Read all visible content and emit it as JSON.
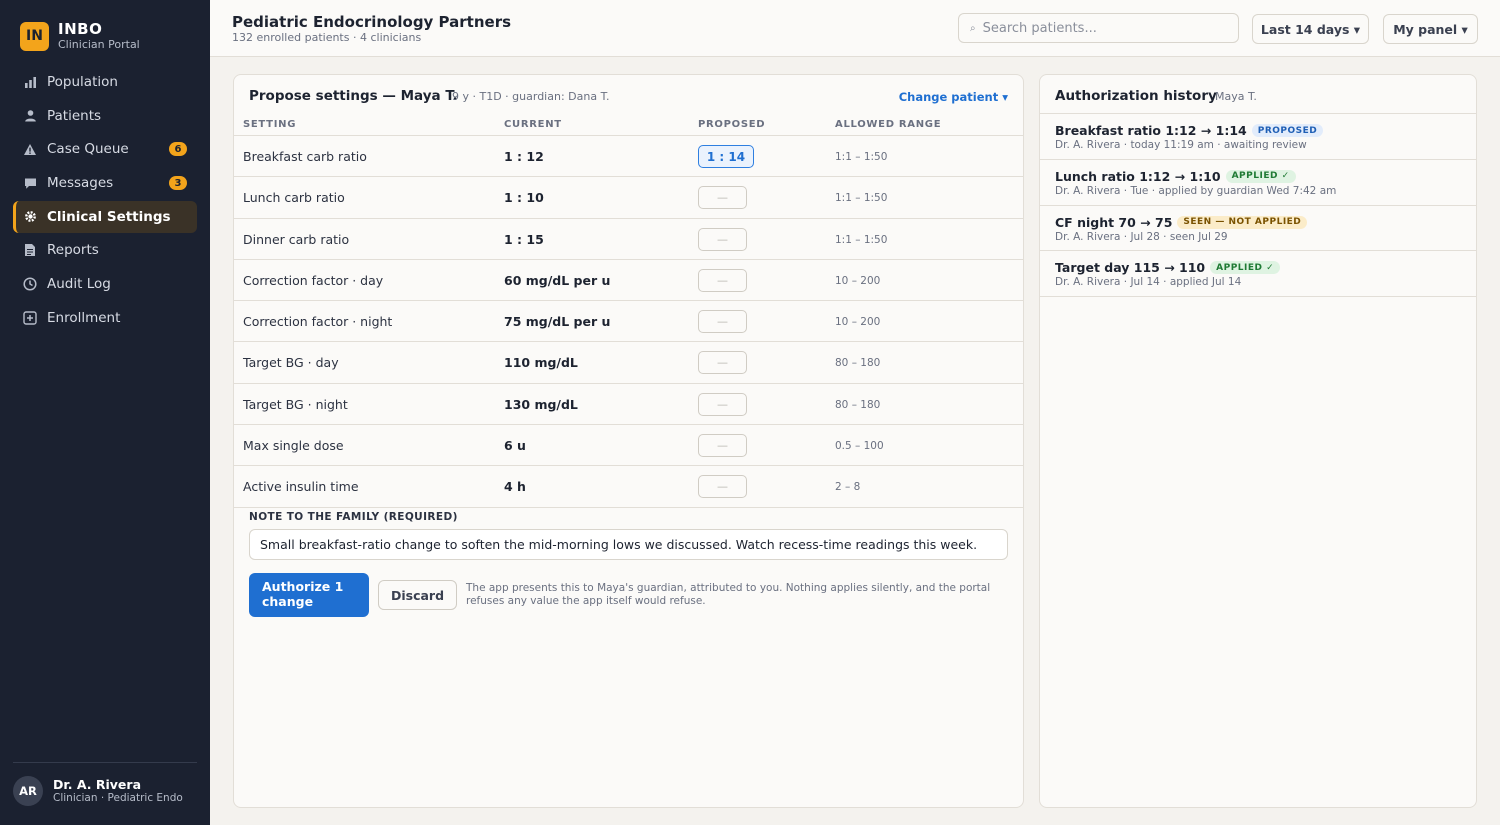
{
  "brand": {
    "logo": "IN",
    "name": "INBO",
    "subtitle": "Clinician Portal"
  },
  "nav": [
    {
      "label": "Population",
      "icon": "bar-chart-icon",
      "badge": ""
    },
    {
      "label": "Patients",
      "icon": "person-icon",
      "badge": ""
    },
    {
      "label": "Case Queue",
      "icon": "warning-icon",
      "badge": "6"
    },
    {
      "label": "Messages",
      "icon": "chat-icon",
      "badge": "3"
    },
    {
      "label": "Clinical Settings",
      "icon": "gear-icon",
      "badge": "",
      "active": true
    },
    {
      "label": "Reports",
      "icon": "document-icon",
      "badge": ""
    },
    {
      "label": "Audit Log",
      "icon": "clock-icon",
      "badge": ""
    },
    {
      "label": "Enrollment",
      "icon": "plus-box-icon",
      "badge": ""
    }
  ],
  "user": {
    "initials": "AR",
    "name": "Dr. A. Rivera",
    "role": "Clinician · Pediatric Endo"
  },
  "header": {
    "title": "Pediatric Endocrinology Partners",
    "subtitle": "132 enrolled patients · 4 clinicians",
    "search_placeholder": "Search patients...",
    "search_icon_glyph": "⌕",
    "range_label": "Last 14 days ▾",
    "panel_label": "My panel ▾"
  },
  "settings_panel": {
    "title": "Propose settings — Maya T.",
    "meta": "9 y · T1D · guardian: Dana T.",
    "change_patient": "Change patient ▾",
    "columns": {
      "setting": "SETTING",
      "current": "CURRENT",
      "proposed": "PROPOSED",
      "range": "ALLOWED RANGE"
    },
    "rows": [
      {
        "setting": "Breakfast carb ratio",
        "current": "1 : 12",
        "proposed": "1 : 14",
        "range": "1:1 – 1:50"
      },
      {
        "setting": "Lunch carb ratio",
        "current": "1 : 10",
        "proposed": "—",
        "range": "1:1 – 1:50"
      },
      {
        "setting": "Dinner carb ratio",
        "current": "1 : 15",
        "proposed": "—",
        "range": "1:1 – 1:50"
      },
      {
        "setting": "Correction factor · day",
        "current": "60 mg/dL per u",
        "proposed": "—",
        "range": "10 – 200"
      },
      {
        "setting": "Correction factor · night",
        "current": "75 mg/dL per u",
        "proposed": "—",
        "range": "10 – 200"
      },
      {
        "setting": "Target BG · day",
        "current": "110 mg/dL",
        "proposed": "—",
        "range": "80 – 180"
      },
      {
        "setting": "Target BG · night",
        "current": "130 mg/dL",
        "proposed": "—",
        "range": "80 – 180"
      },
      {
        "setting": "Max single dose",
        "current": "6 u",
        "proposed": "—",
        "range": "0.5 – 100"
      },
      {
        "setting": "Active insulin time",
        "current": "4 h",
        "proposed": "—",
        "range": "2 – 8"
      }
    ],
    "note_label": "NOTE TO THE FAMILY (REQUIRED)",
    "note_value": "Small breakfast-ratio change to soften the mid-morning lows we discussed. Watch recess-time readings this week.",
    "authorize_label": "Authorize 1 change",
    "discard_label": "Discard",
    "disclaimer": "The app presents this to Maya's guardian, attributed to you. Nothing applies silently, and the portal refuses any value the app itself would refuse."
  },
  "history_panel": {
    "title": "Authorization history",
    "meta": "Maya T.",
    "items": [
      {
        "title": "Breakfast ratio 1:12 → 1:14",
        "badge": "PROPOSED",
        "badge_bg": "#e2ecfb",
        "badge_fg": "#1f5fb5",
        "sub": "Dr. A. Rivera · today 11:19 am · awaiting review"
      },
      {
        "title": "Lunch ratio 1:12 → 1:10",
        "badge": "APPLIED ✓",
        "badge_bg": "#dff3e2",
        "badge_fg": "#1f7a34",
        "sub": "Dr. A. Rivera · Tue · applied by guardian Wed 7:42 am"
      },
      {
        "title": "CF night 70 → 75",
        "badge": "SEEN — NOT APPLIED",
        "badge_bg": "#fbecc9",
        "badge_fg": "#7a5200",
        "sub": "Dr. A. Rivera · Jul 28 · seen Jul 29"
      },
      {
        "title": "Target day 115 → 110",
        "badge": "APPLIED ✓",
        "badge_bg": "#dff3e2",
        "badge_fg": "#1f7a34",
        "sub": "Dr. A. Rivera · Jul 14 · applied Jul 14"
      }
    ]
  },
  "colors": {
    "accent": "#f3a41b",
    "primary": "#1f6fd1",
    "sidebar": "#1b2130"
  }
}
